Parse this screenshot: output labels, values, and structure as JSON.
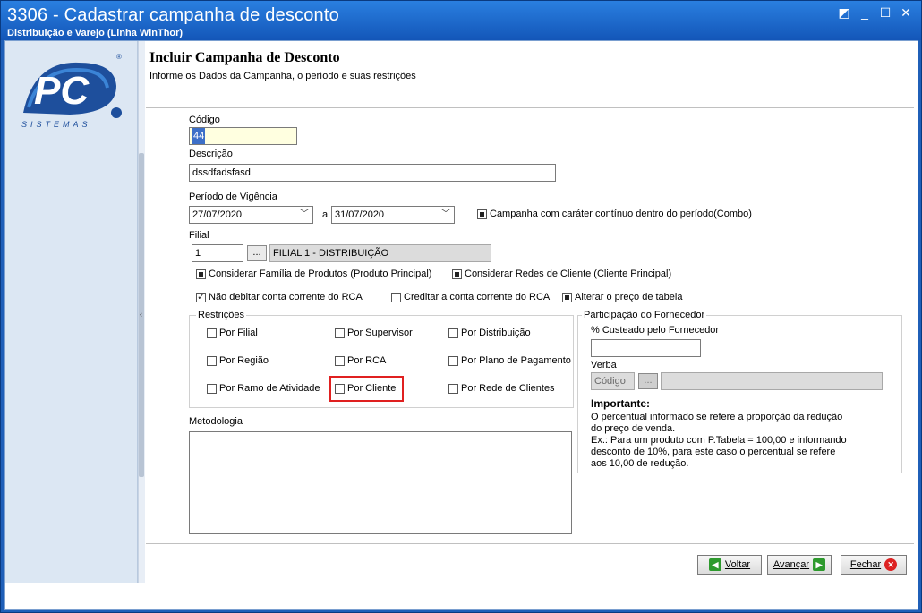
{
  "window": {
    "title": "3306 - Cadastrar campanha de desconto",
    "subtitle": "Distribuição e Varejo (Linha WinThor)"
  },
  "logo": {
    "text": "PC",
    "subtext": "SISTEMAS",
    "mark": "®"
  },
  "header": {
    "title": "Incluir Campanha de Desconto",
    "subtitle": "Informe os Dados da Campanha, o período e suas restrições"
  },
  "form": {
    "codigo_label": "Código",
    "codigo_value": "44",
    "descricao_label": "Descrição",
    "descricao_value": "dssdfadsfasd",
    "periodo_label": "Período de Vigência",
    "data_inicio": "27/07/2020",
    "separador": "a",
    "data_fim": "31/07/2020",
    "campanha_continua": "Campanha com caráter contínuo dentro do período(Combo)",
    "filial_label": "Filial",
    "filial_codigo": "1",
    "filial_nome": "FILIAL 1 - DISTRIBUIÇÃO",
    "ellipsis": "...",
    "considerar_familia": "Considerar Família de Produtos (Produto Principal)",
    "considerar_redes": "Considerar Redes de Cliente (Cliente Principal)",
    "nao_debitar": "Não debitar conta corrente do RCA",
    "creditar": "Creditar a conta corrente do RCA",
    "alterar_preco": "Alterar o preço de tabela"
  },
  "restricoes": {
    "label": "Restrições",
    "items": [
      "Por Filial",
      "Por Supervisor",
      "Por Distribuição",
      "Por Região",
      "Por RCA",
      "Por Plano de Pagamento",
      "Por Ramo de Atividade",
      "Por Cliente",
      "Por Rede de Clientes"
    ]
  },
  "metodologia_label": "Metodologia",
  "fornecedor": {
    "label": "Participação do Fornecedor",
    "custeado_label": "% Custeado pelo Fornecedor",
    "verba_label": "Verba",
    "verba_placeholder": "Código",
    "importante_title": "Importante:",
    "importante_lines": [
      "O percentual informado se refere a proporção da redução",
      "do preço de venda.",
      "Ex.: Para um produto com P.Tabela = 100,00 e informando",
      "desconto de 10%, para este caso o percentual se refere",
      "aos 10,00 de redução."
    ]
  },
  "buttons": {
    "voltar": "Voltar",
    "avancar": "Avançar",
    "fechar": "Fechar"
  },
  "colors": {
    "titlebar": "#1f5fb8",
    "sidebar": "#dce7f3",
    "highlight": "#e02020"
  }
}
